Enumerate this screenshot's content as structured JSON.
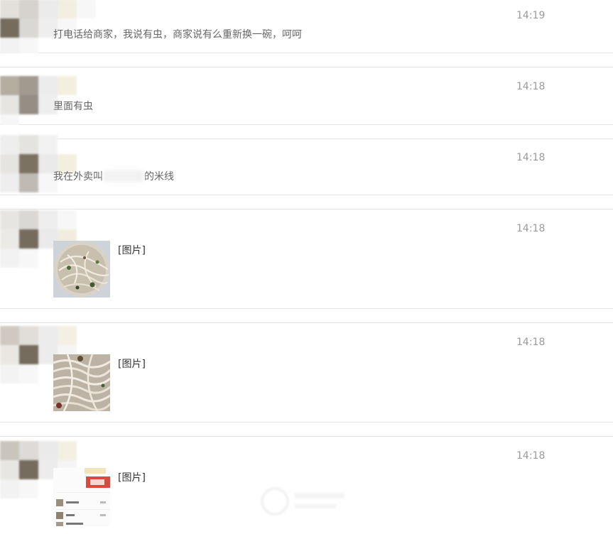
{
  "messages": [
    {
      "time": "14:19",
      "text": "打电话给商家，我说有虫，商家说有么重新换一碗，呵呵"
    },
    {
      "time": "14:18",
      "text": "里面有虫"
    },
    {
      "time": "14:18",
      "text_before": "我在外卖叫",
      "text_after": "的米线"
    },
    {
      "time": "14:18",
      "image_label": "[图片]",
      "image_kind": "noodle-bowl-photo"
    },
    {
      "time": "14:18",
      "image_label": "[图片]",
      "image_kind": "noodles-closeup-photo"
    },
    {
      "time": "14:18",
      "image_label": "[图片]",
      "image_kind": "order-screenshot"
    }
  ],
  "colors": {
    "time": "#9a9a9a",
    "text": "#666666",
    "image_label": "#333333",
    "divider": "#e3e3e3"
  }
}
